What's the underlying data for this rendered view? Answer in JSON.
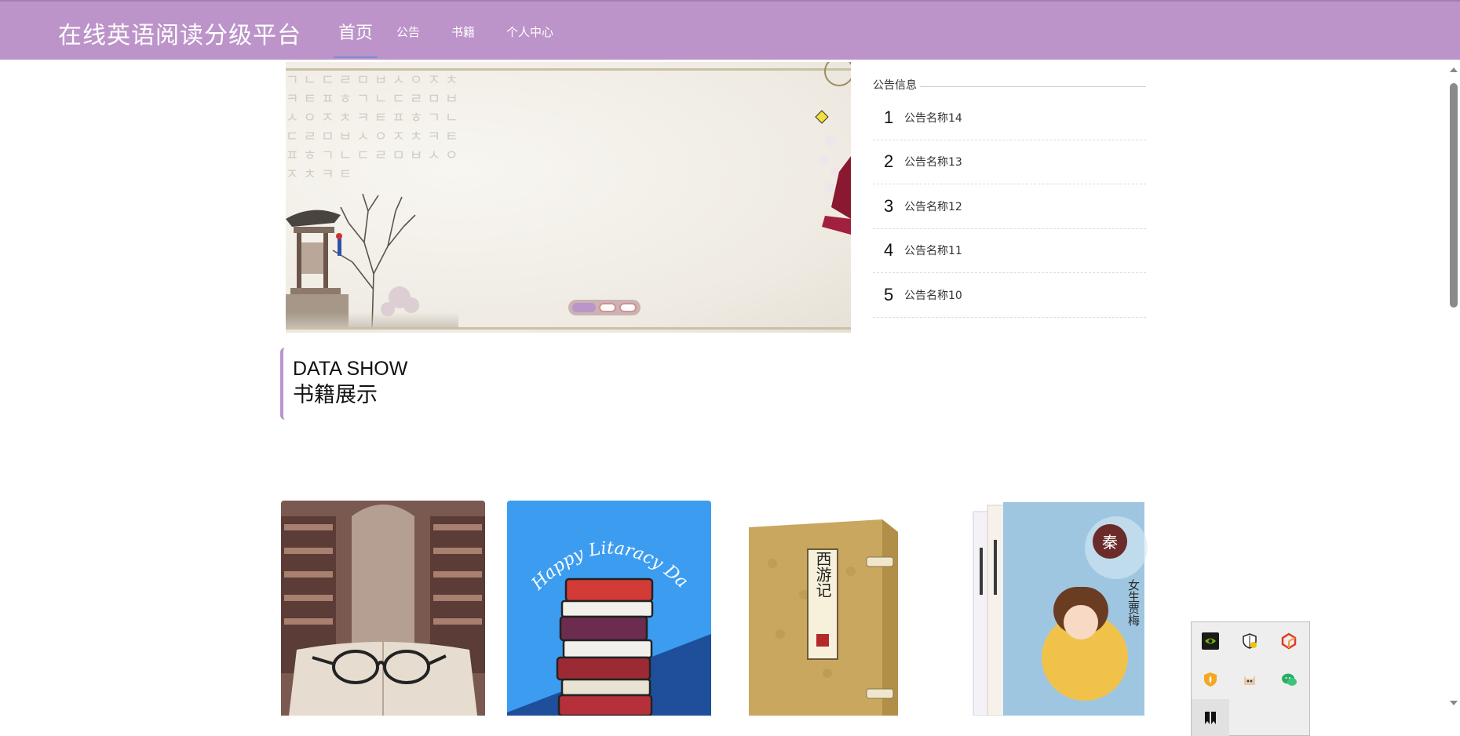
{
  "header": {
    "brand": "在线英语阅读分级平台",
    "nav": [
      {
        "label": "首页",
        "active": true
      },
      {
        "label": "公告",
        "active": false
      },
      {
        "label": "书籍",
        "active": false
      },
      {
        "label": "个人中心",
        "active": false
      }
    ],
    "accent_color": "#bc94c9"
  },
  "banner": {
    "glyphs": "ㄱㄴㄷㄹㅁㅂㅅㅇㅈㅊㅋㅌㅍㅎㄱㄴㄷㄹㅁㅂㅅㅇㅈㅊㅋㅌㅍㅎㄱㄴㄷㄹㅁㅂㅅㅇㅈㅊㅋㅌㅍㅎㄱㄴㄷㄹㅁㅂㅅㅇㅈㅊㅋㅌ",
    "slide_count": 3,
    "active_slide": 1
  },
  "notices": {
    "title": "公告信息",
    "items": [
      {
        "num": "1",
        "name": "公告名称14"
      },
      {
        "num": "2",
        "name": "公告名称13"
      },
      {
        "num": "3",
        "name": "公告名称12"
      },
      {
        "num": "4",
        "name": "公告名称11"
      },
      {
        "num": "5",
        "name": "公告名称10"
      }
    ]
  },
  "section": {
    "en": "DATA SHOW",
    "cn": "书籍展示"
  },
  "books": [
    {
      "cover": "library-glasses"
    },
    {
      "cover": "happy-litaracy-day",
      "cover_text": "Happy Litaracy Day!"
    },
    {
      "cover": "xiyouji-box",
      "cover_text": "西游记"
    },
    {
      "cover": "nvsheng-jiamei",
      "cover_text": "女生贾梅",
      "badge": "秦"
    }
  ],
  "tray_icons": [
    "nvidia-icon",
    "security-shield-icon",
    "app-cube-icon",
    "firewall-icon",
    "cat-icon",
    "wechat-icon",
    "bookmark-icon"
  ]
}
